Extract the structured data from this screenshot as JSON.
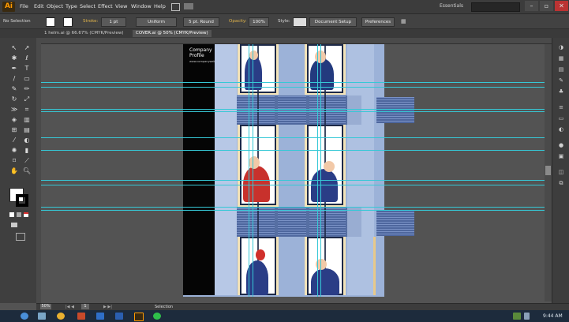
{
  "app": {
    "logo": "Ai",
    "menu": [
      "File",
      "Edit",
      "Object",
      "Type",
      "Select",
      "Effect",
      "View",
      "Window",
      "Help"
    ],
    "workspace": "Essentials",
    "window_controls": [
      "–",
      "▫",
      "✕"
    ]
  },
  "control_bar": {
    "selection_label": "No Selection",
    "stroke_label": "Stroke:",
    "stroke_value": "1 pt",
    "profile_value": "Uniform",
    "brush_value": "5 pt. Round",
    "opacity_label": "Opacity:",
    "opacity_value": "100%",
    "style_label": "Style:",
    "document_setup_label": "Document Setup",
    "preferences_label": "Preferences"
  },
  "tabs": [
    {
      "label": "1 helm.ai @ 66.67% (CMYK/Preview)"
    },
    {
      "label": "COVER.ai @ 50% (CMYK/Preview)"
    }
  ],
  "artboard": {
    "title_line1": "Company",
    "title_line2": "Profile",
    "website": "www.companyweb.com"
  },
  "status_bar": {
    "zoom": "50%",
    "page": "1",
    "tool": "Selection"
  },
  "taskbar": {
    "clock": "9:44 AM"
  },
  "colors": {
    "accent_guides": "#36c8d6",
    "building_blue": "#9cb2d8",
    "band_blue": "#566fa3",
    "navy": "#1e2a48",
    "red": "#d0302c"
  }
}
